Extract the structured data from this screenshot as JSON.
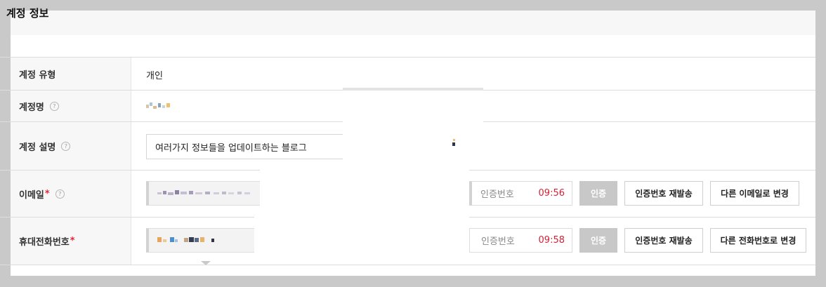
{
  "section": {
    "title": "계정 정보"
  },
  "account_type": {
    "label": "계정 유형",
    "value": "개인"
  },
  "account_name": {
    "label": "계정명",
    "help_icon": "help-circle-icon"
  },
  "account_desc": {
    "label": "계정 설명",
    "value": "여러가지 정보들을 업데이트하는 블로그",
    "help_icon": "help-circle-icon"
  },
  "email": {
    "label": "이메일",
    "required_mark": "*",
    "code_placeholder": "인증번호",
    "timer": "09:56",
    "verify_label": "인증",
    "resend_label": "인증번호 재발송",
    "change_label": "다른 이메일로 변경"
  },
  "phone": {
    "label": "휴대전화번호",
    "required_mark": "*",
    "code_placeholder": "인증번호",
    "timer": "09:58",
    "verify_label": "인증",
    "resend_label": "인증번호 재발송",
    "change_label": "다른 전화번호로 변경"
  },
  "colors": {
    "required": "#e0283a",
    "timer": "#d61f35",
    "disabled_button": "#c8c8c8"
  }
}
